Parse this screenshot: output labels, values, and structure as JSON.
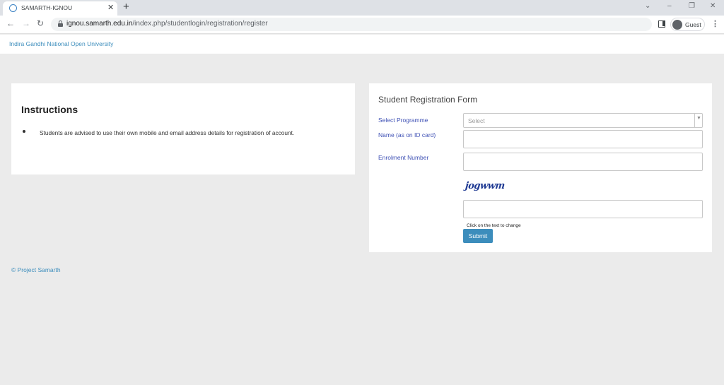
{
  "browser": {
    "tab_title": "SAMARTH-IGNOU",
    "tab_close": "✕",
    "new_tab": "+",
    "url_host": "ignou.samarth.edu.in",
    "url_path": "/index.php/studentlogin/registration/register",
    "profile_label": "Guest",
    "icons": [
      "back-icon",
      "forward-icon",
      "reload-icon",
      "lock-icon",
      "side-panel-icon",
      "avatar-icon",
      "menu-icon"
    ]
  },
  "header": {
    "brand": "Indira Gandhi National Open University"
  },
  "instructions": {
    "title": "Instructions",
    "items": [
      "Students are advised to use their own mobile and email address details for registration of account."
    ]
  },
  "form": {
    "title": "Student Registration Form",
    "programme_label": "Select Programme",
    "programme_placeholder": "Select",
    "name_label": "Name (as on ID card)",
    "name_value": "",
    "enrolment_label": "Enrolment Number",
    "enrolment_value": "",
    "captcha_text": "jogwwm",
    "captcha_value": "",
    "captcha_hint": "Click on the text to change",
    "submit_label": "Submit"
  },
  "footer": {
    "text": "© Project Samarth"
  },
  "colors": {
    "accent": "#3c8dbc",
    "label": "#3f51b5",
    "background": "#ebebeb"
  }
}
